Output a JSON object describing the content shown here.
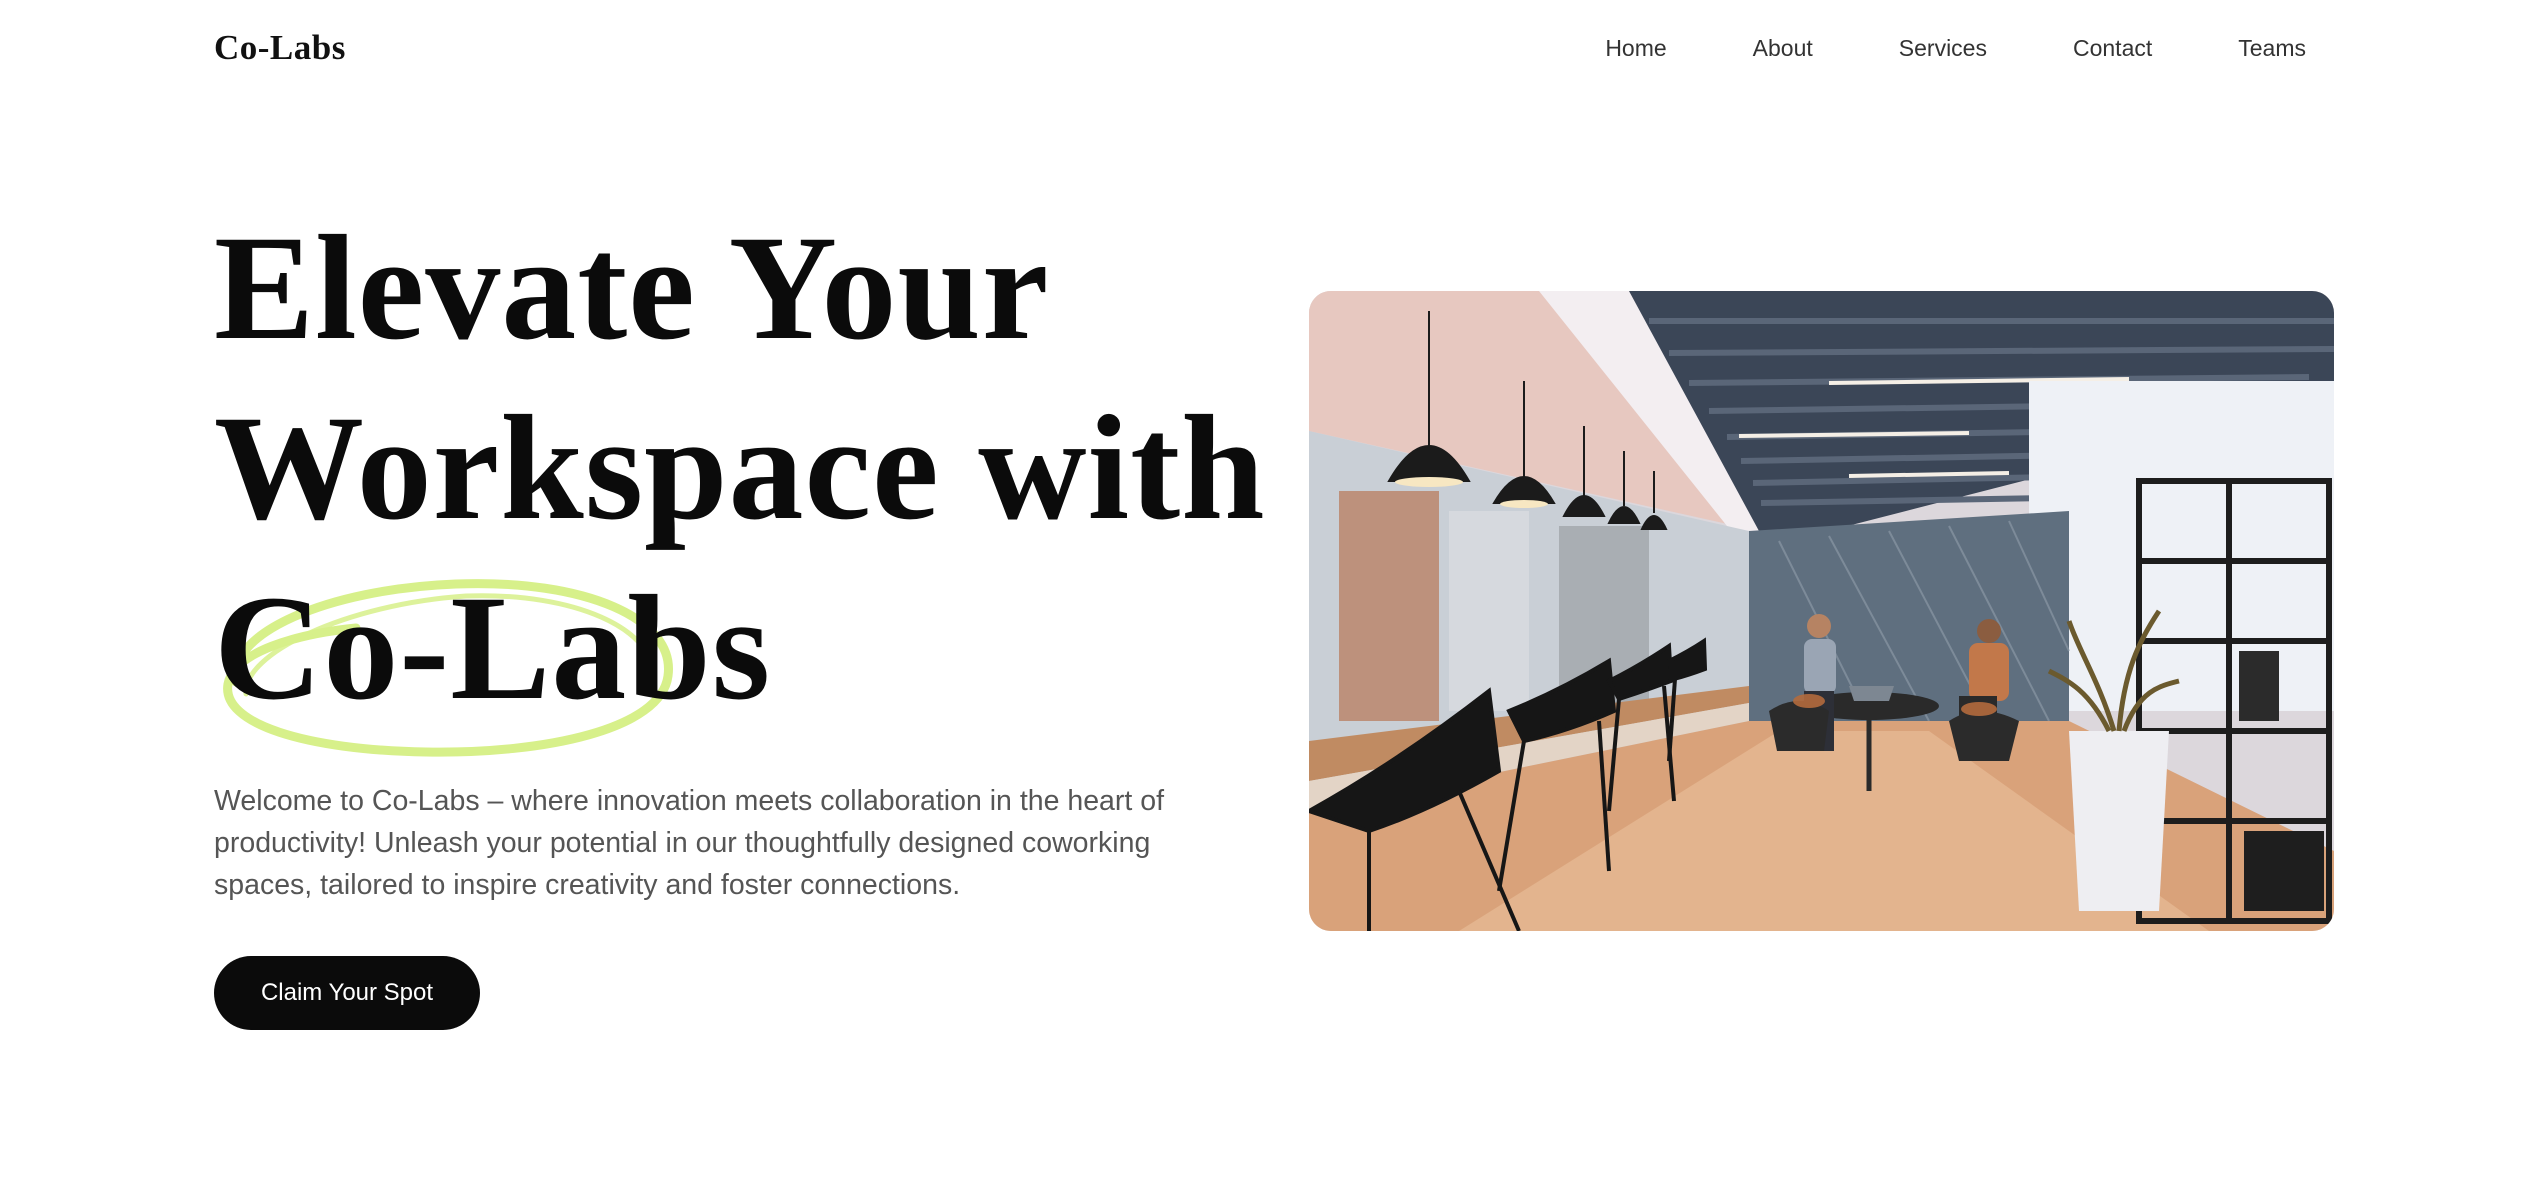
{
  "brand": "Co-Labs",
  "nav": {
    "items": [
      {
        "label": "Home"
      },
      {
        "label": "About"
      },
      {
        "label": "Services"
      },
      {
        "label": "Contact"
      },
      {
        "label": "Teams"
      }
    ]
  },
  "hero": {
    "title_line1": "Elevate Your",
    "title_line2": "Workspace with",
    "title_highlight": "Co-Labs",
    "description": "Welcome to Co-Labs – where innovation meets collaboration in the heart of productivity! Unleash your potential in our thoughtfully designed coworking spaces, tailored to inspire creativity and foster connections.",
    "cta_label": "Claim Your Spot",
    "highlight_color": "#d7f08a"
  },
  "colors": {
    "text": "#0b0b0b",
    "muted": "#555555",
    "button_bg": "#0b0b0b",
    "button_text": "#ffffff"
  }
}
